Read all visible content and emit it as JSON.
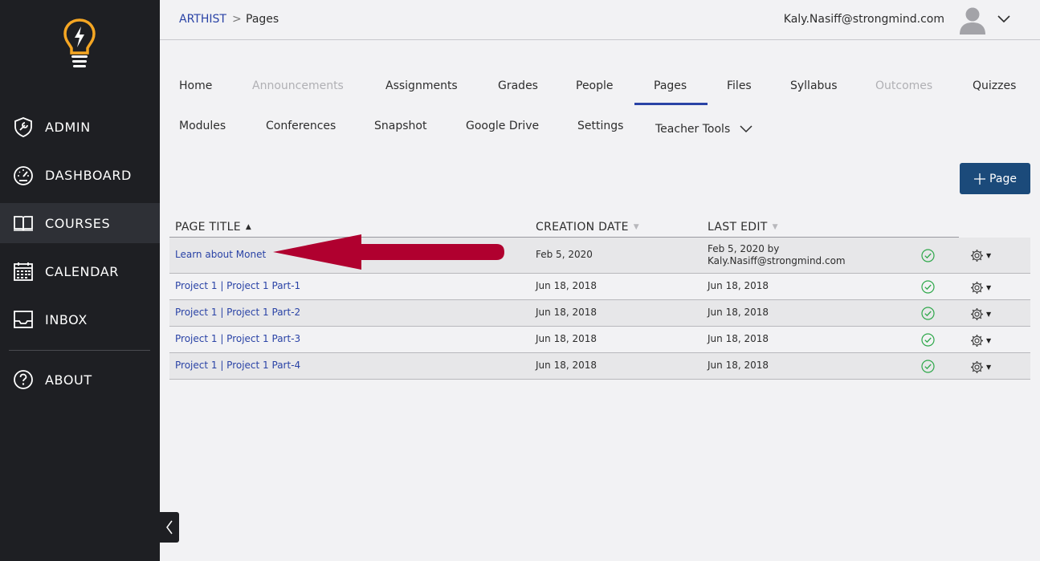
{
  "sidebar": {
    "items": [
      {
        "label": "ADMIN",
        "icon": "shield-wrench-icon"
      },
      {
        "label": "DASHBOARD",
        "icon": "speedometer-icon"
      },
      {
        "label": "COURSES",
        "icon": "open-book-icon"
      },
      {
        "label": "CALENDAR",
        "icon": "calendar-icon"
      },
      {
        "label": "INBOX",
        "icon": "inbox-tray-icon"
      },
      {
        "label": "ABOUT",
        "icon": "question-circle-icon"
      }
    ],
    "active": "COURSES"
  },
  "header": {
    "breadcrumb_course": "ARTHIST",
    "breadcrumb_sep": ">",
    "breadcrumb_current": "Pages",
    "user_email": "Kaly.Nasiff@strongmind.com"
  },
  "tabs": [
    {
      "label": "Home",
      "disabled": false
    },
    {
      "label": "Announcements",
      "disabled": true
    },
    {
      "label": "Assignments",
      "disabled": false
    },
    {
      "label": "Grades",
      "disabled": false
    },
    {
      "label": "People",
      "disabled": false
    },
    {
      "label": "Pages",
      "disabled": false,
      "active": true
    },
    {
      "label": "Files",
      "disabled": false
    },
    {
      "label": "Syllabus",
      "disabled": false
    },
    {
      "label": "Outcomes",
      "disabled": true
    },
    {
      "label": "Quizzes",
      "disabled": false
    },
    {
      "label": "Modules",
      "disabled": false
    },
    {
      "label": "Conferences",
      "disabled": false
    },
    {
      "label": "Snapshot",
      "disabled": false
    },
    {
      "label": "Google Drive",
      "disabled": false
    },
    {
      "label": "Settings",
      "disabled": false
    },
    {
      "label": "Teacher Tools",
      "disabled": false
    }
  ],
  "add_page_label": "Page",
  "table": {
    "columns": [
      "PAGE TITLE",
      "CREATION DATE",
      "LAST EDIT"
    ],
    "sort_column": "PAGE TITLE",
    "rows": [
      {
        "title": "Learn about Monet",
        "created": "Feb 5, 2020",
        "edited_line1": "Feb 5, 2020 by",
        "edited_line2": "Kaly.Nasiff@strongmind.com",
        "published": true
      },
      {
        "title": "Project 1 | Project 1 Part-1",
        "created": "Jun 18, 2018",
        "edited_line1": "Jun 18, 2018",
        "edited_line2": "",
        "published": true
      },
      {
        "title": "Project 1 | Project 1 Part-2",
        "created": "Jun 18, 2018",
        "edited_line1": "Jun 18, 2018",
        "edited_line2": "",
        "published": true
      },
      {
        "title": "Project 1 | Project 1 Part-3",
        "created": "Jun 18, 2018",
        "edited_line1": "Jun 18, 2018",
        "edited_line2": "",
        "published": true
      },
      {
        "title": "Project 1 | Project 1 Part-4",
        "created": "Jun 18, 2018",
        "edited_line1": "Jun 18, 2018",
        "edited_line2": "",
        "published": true
      }
    ]
  },
  "colors": {
    "sidebar_bg": "#1e1f23",
    "link": "#2a43a6",
    "button": "#1b4a7a",
    "published_green": "#2ea84a",
    "annotation_arrow": "#b0002f",
    "logo_orange": "#f5a623"
  }
}
